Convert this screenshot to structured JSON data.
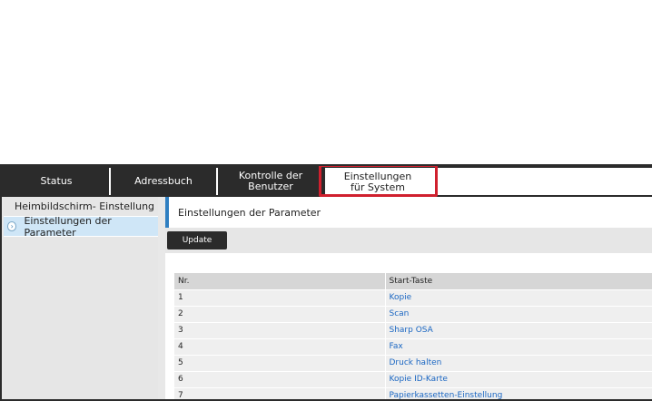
{
  "tabs": [
    {
      "label": "Status"
    },
    {
      "label": "Adressbuch"
    },
    {
      "label": "Kontrolle der\nBenutzer"
    },
    {
      "label": "Einstellungen\nfür System"
    }
  ],
  "sidebar": {
    "items": [
      {
        "label": "Heimbildschirm- Einstellung"
      },
      {
        "label": "Einstellungen der Parameter"
      }
    ]
  },
  "main": {
    "title": "Einstellungen der Parameter",
    "update_label": "Update",
    "table": {
      "headers": [
        "Nr.",
        "Start-Taste"
      ],
      "rows": [
        {
          "nr": "1",
          "key": "Kopie"
        },
        {
          "nr": "2",
          "key": "Scan"
        },
        {
          "nr": "3",
          "key": "Sharp OSA"
        },
        {
          "nr": "4",
          "key": "Fax"
        },
        {
          "nr": "5",
          "key": "Druck halten"
        },
        {
          "nr": "6",
          "key": "Kopie ID-Karte"
        },
        {
          "nr": "7",
          "key": "Papierkassetten-Einstellung"
        }
      ]
    }
  },
  "colors": {
    "accent": "#2f7fc1",
    "highlight": "#d0202e",
    "link": "#1a66c2"
  }
}
